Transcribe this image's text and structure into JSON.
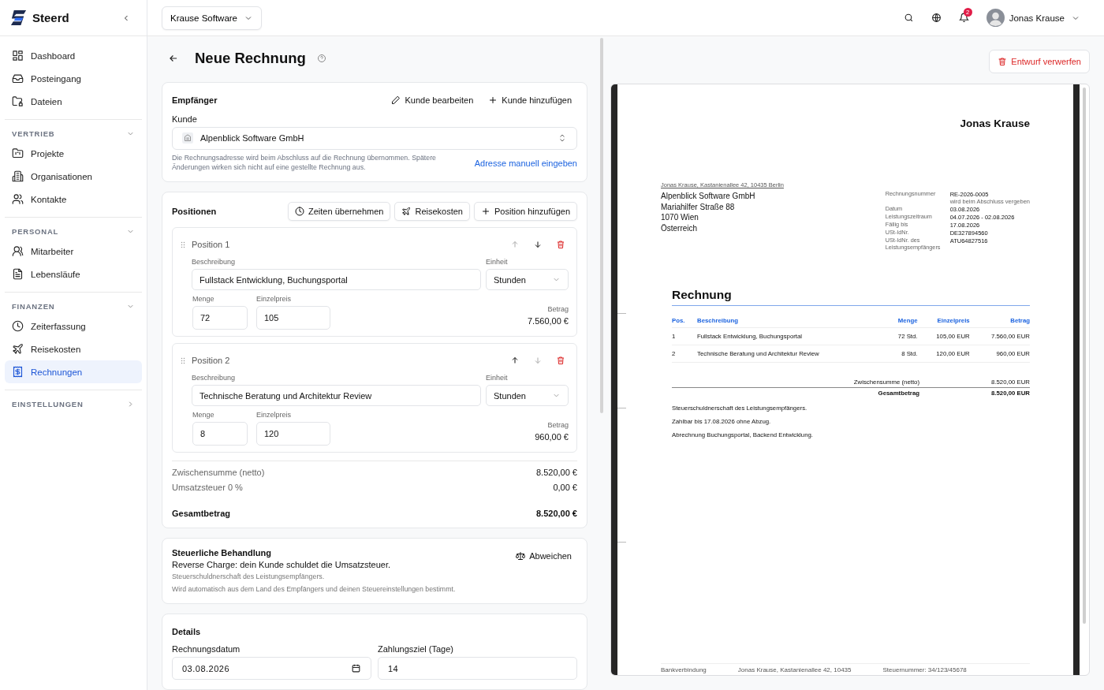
{
  "app": {
    "name": "Steerd"
  },
  "topbar": {
    "company": "Krause Software",
    "notification_count": "2",
    "user": "Jonas Krause"
  },
  "sidebar": {
    "items": [
      {
        "label": "Dashboard",
        "selected": false
      },
      {
        "label": "Posteingang",
        "selected": false
      },
      {
        "label": "Dateien",
        "selected": false
      }
    ],
    "sections": [
      {
        "heading": "VERTRIEB",
        "expanded": true,
        "items": [
          {
            "label": "Projekte",
            "selected": false
          },
          {
            "label": "Organisationen",
            "selected": false
          },
          {
            "label": "Kontakte",
            "selected": false
          }
        ]
      },
      {
        "heading": "PERSONAL",
        "expanded": true,
        "items": [
          {
            "label": "Mitarbeiter",
            "selected": false
          },
          {
            "label": "Lebensläufe",
            "selected": false
          }
        ]
      },
      {
        "heading": "FINANZEN",
        "expanded": true,
        "items": [
          {
            "label": "Zeiterfassung",
            "selected": false
          },
          {
            "label": "Reisekosten",
            "selected": false
          },
          {
            "label": "Rechnungen",
            "selected": true
          }
        ]
      },
      {
        "heading": "EINSTELLUNGEN",
        "expanded": false
      }
    ]
  },
  "page": {
    "title": "Neue Rechnung"
  },
  "recipient": {
    "title": "Empfänger",
    "actions": [
      "Kunde bearbeiten",
      "Kunde hinzufügen"
    ],
    "field_label": "Kunde",
    "value": "Alpenblick Software GmbH",
    "hint": "Die Rechnungsadresse wird beim Abschluss auf die Rechnung übernommen. Spätere Änderungen wirken sich nicht auf eine gestellte Rechnung aus.",
    "link": "Adresse manuell eingeben"
  },
  "positions": {
    "title": "Positionen",
    "actions": [
      "Zeiten übernehmen",
      "Reisekosten",
      "Position hinzufügen"
    ],
    "items": [
      {
        "label": "Position 1",
        "up_disabled": true,
        "down_disabled": false,
        "description_label": "Beschreibung",
        "description": "Fullstack Entwicklung, Buchungsportal",
        "unit_label": "Einheit",
        "unit": "Stunden",
        "quantity_label": "Menge",
        "quantity": "72",
        "price_label": "Einzelpreis",
        "price": "105",
        "amount_label": "Betrag",
        "amount": "7.560,00 €"
      },
      {
        "label": "Position 2",
        "up_disabled": false,
        "down_disabled": true,
        "description_label": "Beschreibung",
        "description": "Technische Beratung und Architektur Review",
        "unit_label": "Einheit",
        "unit": "Stunden",
        "quantity_label": "Menge",
        "quantity": "8",
        "price_label": "Einzelpreis",
        "price": "120",
        "amount_label": "Betrag",
        "amount": "960,00 €"
      }
    ],
    "totals": [
      {
        "label": "Zwischensumme (netto)",
        "value": "8.520,00 €",
        "kind": "line"
      },
      {
        "label": "Umsatzsteuer 0 %",
        "value": "0,00 €",
        "kind": "line"
      },
      {
        "label": "Gesamtbetrag",
        "value": "8.520,00 €",
        "kind": "total"
      }
    ]
  },
  "tax": {
    "title": "Steuerliche Behandlung",
    "summary": "Reverse Charge: dein Kunde schuldet die Umsatzsteuer.",
    "notes": [
      "Steuerschuldnerschaft des Leistungsempfängers.",
      "Wird automatisch aus dem Land des Empfängers und deinen Steuereinstellungen bestimmt."
    ],
    "action": "Abweichen"
  },
  "details": {
    "title": "Details",
    "fields": [
      {
        "label": "Rechnungsdatum",
        "value": "03.08.2026",
        "kind": "date"
      },
      {
        "label": "Zahlungsziel (Tage)",
        "value": "14",
        "kind": "number"
      }
    ]
  },
  "preview": {
    "discard": "Entwurf verwerfen",
    "sender": "Jonas Krause",
    "return_address": "Jonas Krause, Kastanienallee 42, 10435 Berlin",
    "address": [
      "Alpenblick Software GmbH",
      "Mariahilfer Straße 88",
      "1070 Wien",
      "Österreich"
    ],
    "meta": [
      {
        "label": "Rechnungsnummer",
        "value": "RE-2026-0005",
        "note": "wird beim Abschluss vergeben"
      },
      {
        "label": "Datum",
        "value": "03.08.2026"
      },
      {
        "label": "Leistungszeitraum",
        "value": "04.07.2026 - 02.08.2026"
      },
      {
        "label": "Fällig bis",
        "value": "17.08.2026"
      },
      {
        "label": "USt-IdNr.",
        "value": "DE327894560"
      },
      {
        "label": "USt-IdNr. des Leistungsempfängers",
        "value": "ATU64827516"
      }
    ],
    "title": "Rechnung",
    "columns": [
      "Pos.",
      "Beschreibung",
      "Menge",
      "Einzelpreis",
      "Betrag"
    ],
    "rows": [
      [
        "1",
        "Fullstack Entwicklung, Buchungsportal",
        "72 Std.",
        "105,00 EUR",
        "7.560,00 EUR"
      ],
      [
        "2",
        "Technische Beratung und Architektur Review",
        "8 Std.",
        "120,00 EUR",
        "960,00 EUR"
      ]
    ],
    "totals": [
      {
        "label": "Zwischensumme (netto)",
        "value": "8.520,00 EUR",
        "kind": "line"
      },
      {
        "label": "Gesamtbetrag",
        "value": "8.520,00 EUR",
        "kind": "total"
      }
    ],
    "notes": [
      "Steuerschuldnerschaft des Leistungsempfängers.",
      "Zahlbar bis 17.08.2026 ohne Abzug.",
      "Abrechnung Buchungsportal, Backend Entwicklung."
    ],
    "footer": [
      "Bankverbindung",
      "Jonas Krause, Kastanienallee 42, 10435",
      "Steuernummer: 34/123/45678"
    ]
  }
}
